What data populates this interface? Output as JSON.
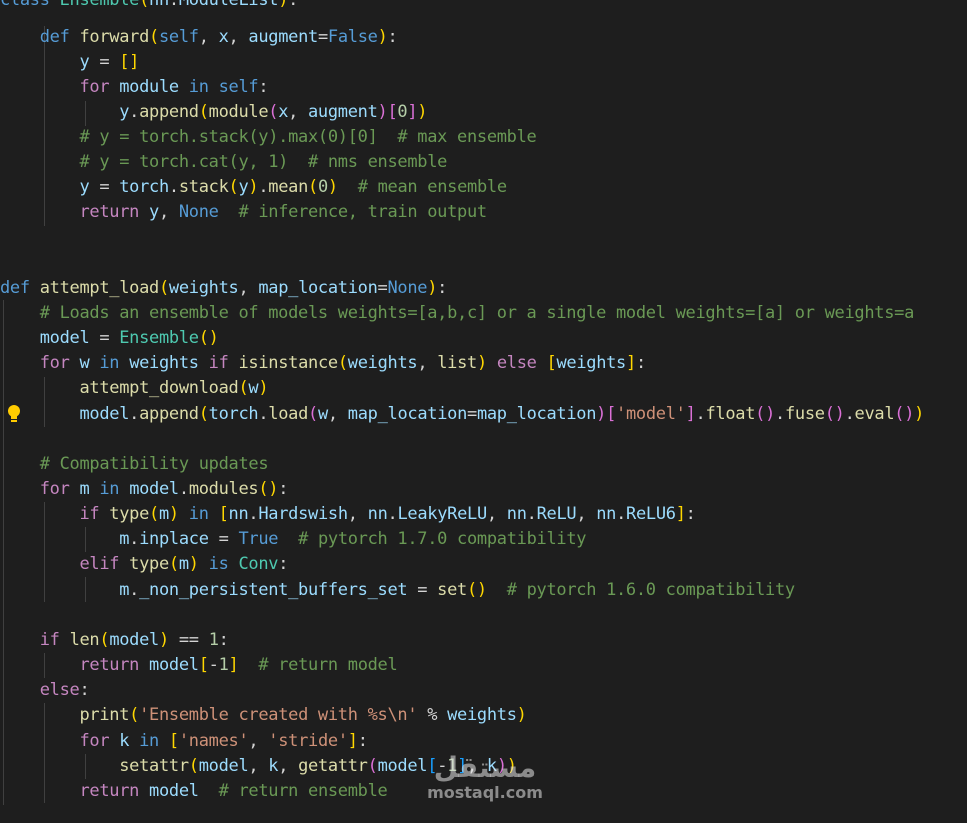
{
  "editor": {
    "theme_colors": {
      "background": "#1e1e1e",
      "keyword": "#569cd6",
      "control": "#c586c0",
      "function": "#dcdcaa",
      "class": "#4ec9b0",
      "variable": "#9cdcfe",
      "string": "#ce9178",
      "comment": "#6a9955",
      "number": "#b5cea8",
      "selection": "#264f78"
    },
    "gutter_icon": "lightbulb-icon",
    "lines": [
      "class Ensemble(nn.ModuleList):",
      "    def forward(self, x, augment=False):",
      "        y = []",
      "        for module in self:",
      "            y.append(module(x, augment)[0])",
      "        # y = torch.stack(y).max(0)[0]  # max ensemble",
      "        # y = torch.cat(y, 1)  # nms ensemble",
      "        y = torch.stack(y).mean(0)  # mean ensemble",
      "        return y, None  # inference, train output",
      "",
      "",
      "def attempt_load(weights, map_location=None):",
      "    # Loads an ensemble of models weights=[a,b,c] or a single model weights=[a] or weights=a",
      "    model = Ensemble()",
      "    for w in weights if isinstance(weights, list) else [weights]:",
      "        attempt_download(w)",
      "        model.append(torch.load(w, map_location=map_location)['model'].float().fuse().eval())",
      "",
      "    # Compatibility updates",
      "    for m in model.modules():",
      "        if type(m) in [nn.Hardswish, nn.LeakyReLU, nn.ReLU, nn.ReLU6]:",
      "            m.inplace = True  # pytorch 1.7.0 compatibility",
      "        elif type(m) is Conv:",
      "            m._non_persistent_buffers_set = set()  # pytorch 1.6.0 compatibility",
      "",
      "    if len(model) == 1:",
      "        return model[-1]  # return model",
      "    else:",
      "        print('Ensemble created with %s\\n' % weights)",
      "        for k in ['names', 'stride']:",
      "            setattr(model, k, getattr(model[-1], k))",
      "        return model  # return ensemble"
    ]
  },
  "watermark": {
    "arabic": "مستقل",
    "latin": "mostaql.com"
  }
}
